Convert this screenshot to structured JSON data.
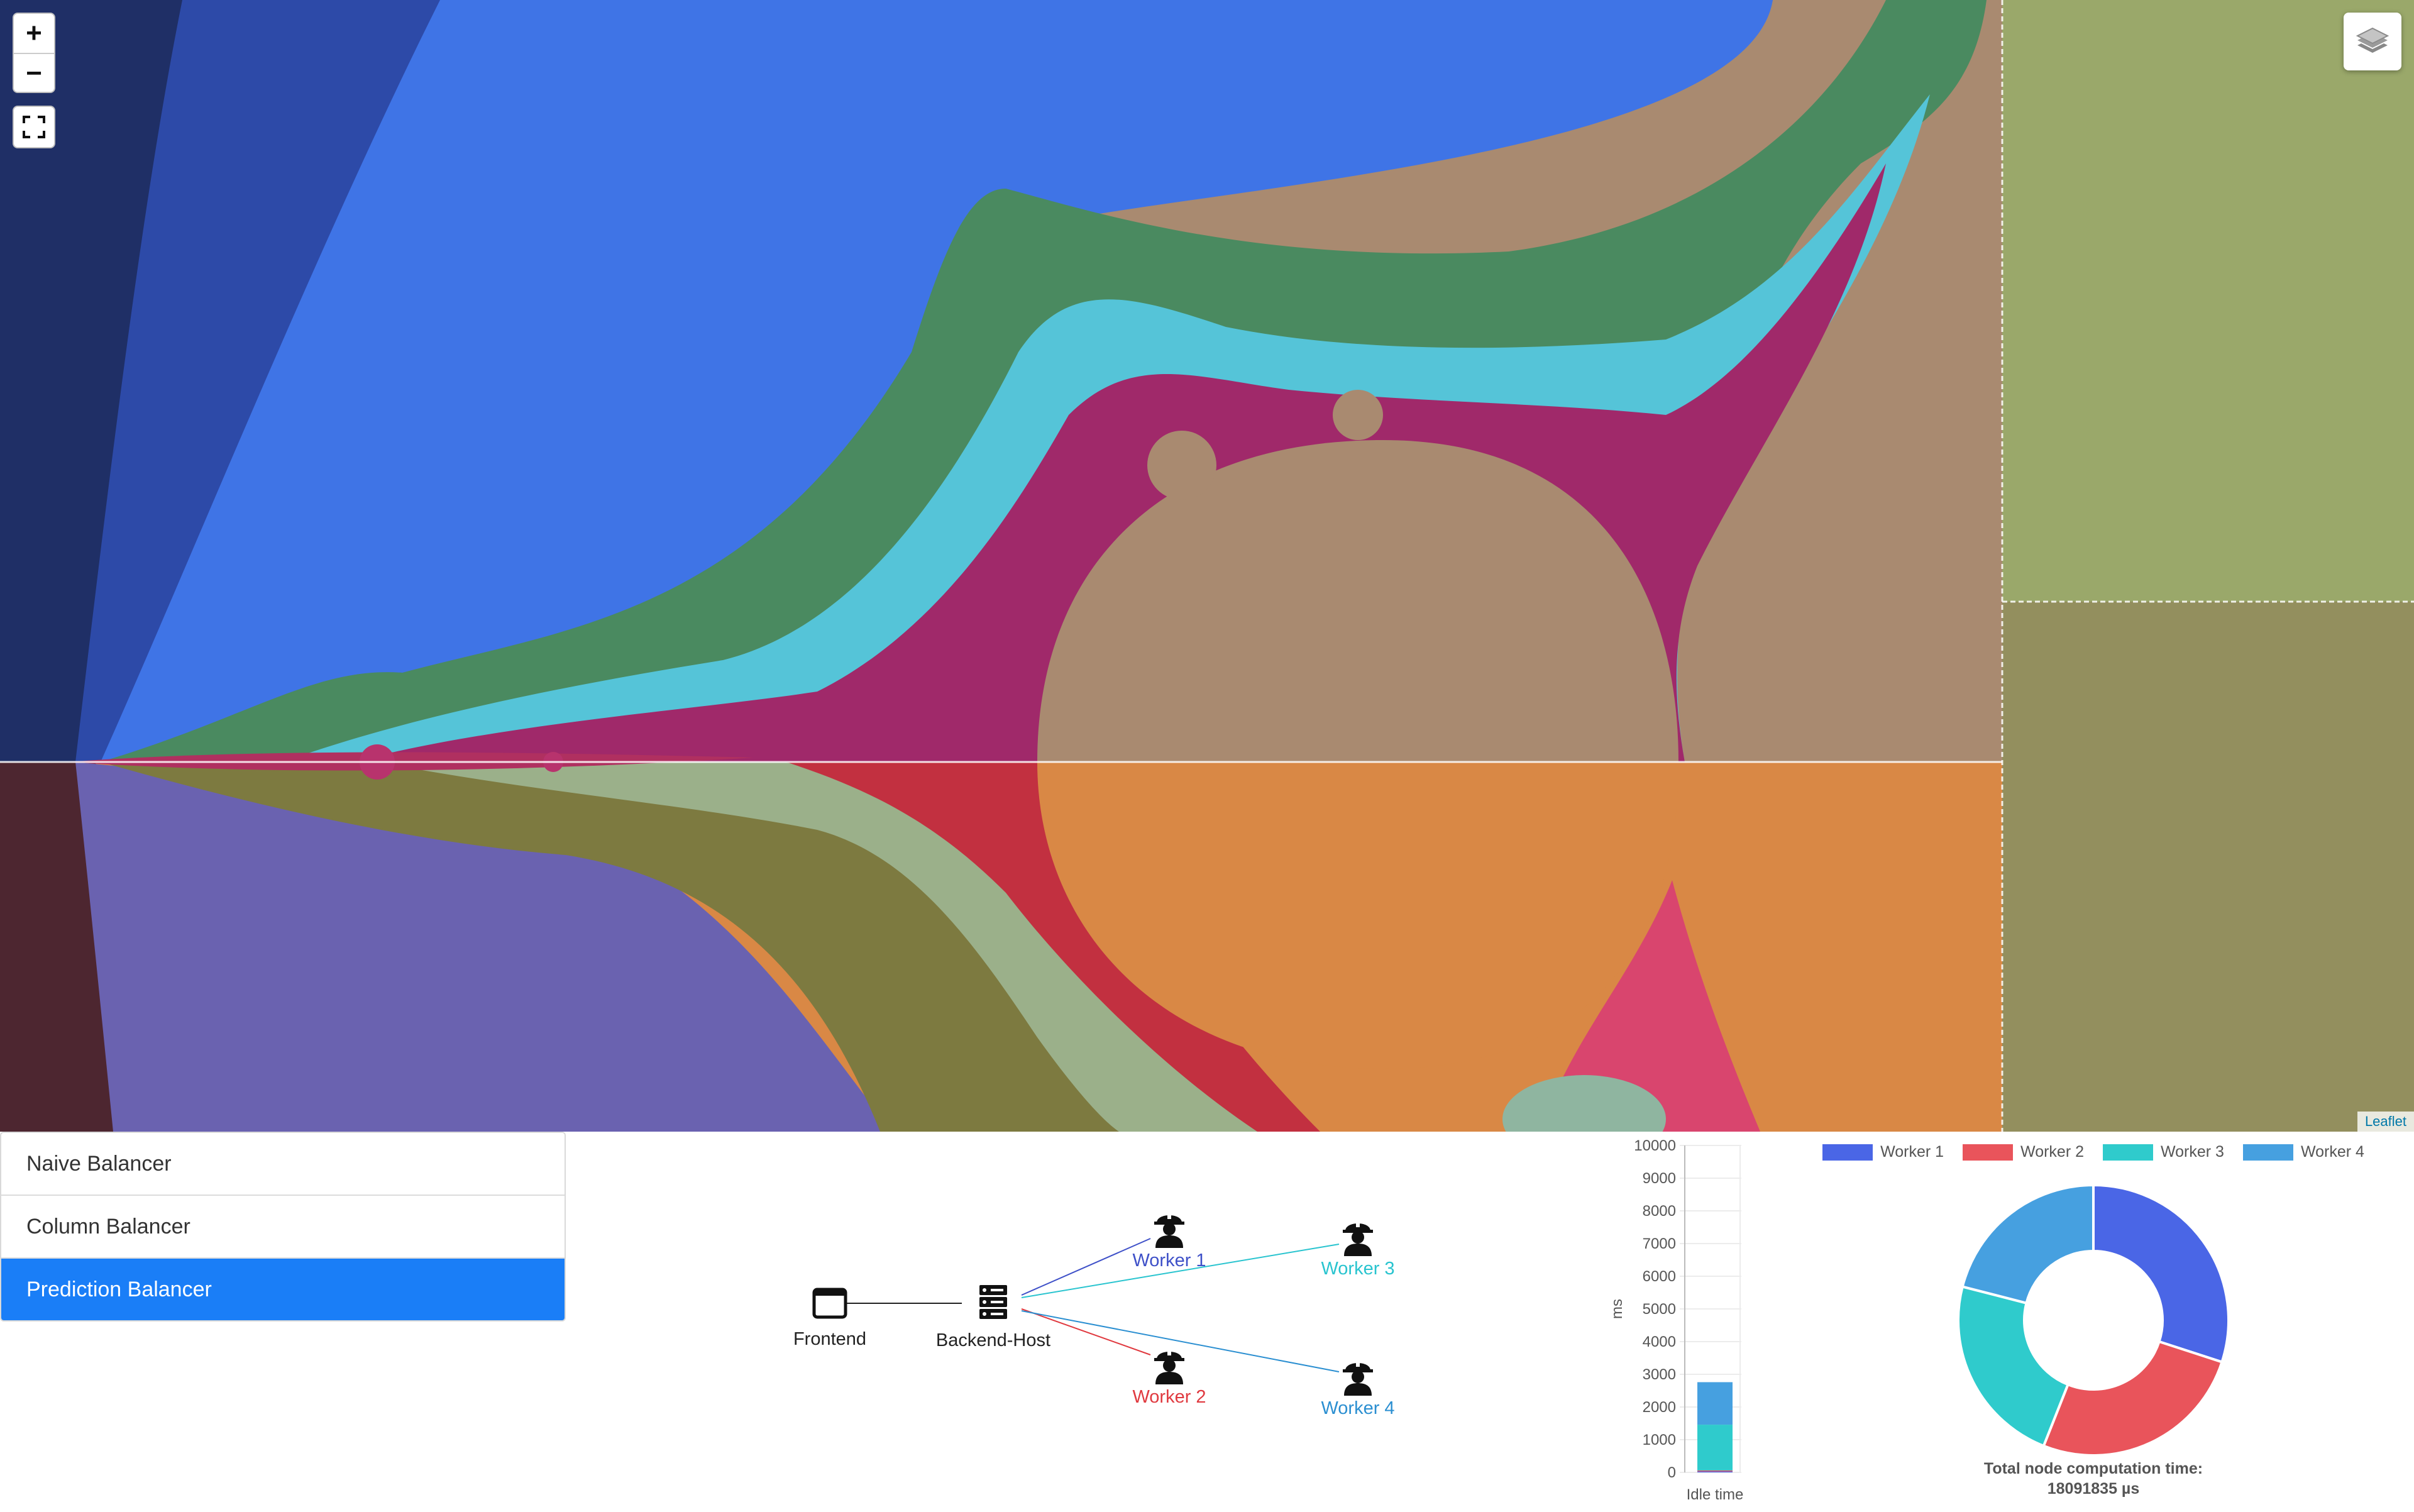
{
  "map": {
    "zoom_in_label": "+",
    "zoom_out_label": "−",
    "attribution": "Leaflet",
    "colors": {
      "deep_blue": "#1f2f66",
      "blue": "#3f74e6",
      "green": "#4a8a60",
      "cyan": "#55c4d8",
      "magenta": "#a0296a",
      "tan": "#a98a70",
      "orange": "#d98845",
      "maroon": "#4d2630",
      "purple": "#6a62b0",
      "olive": "#9aa86a",
      "olive_dark": "#938f5e"
    }
  },
  "balancers": {
    "items": [
      {
        "label": "Naive Balancer",
        "active": false
      },
      {
        "label": "Column Balancer",
        "active": false
      },
      {
        "label": "Prediction Balancer",
        "active": true
      }
    ]
  },
  "topology": {
    "frontend": "Frontend",
    "backend": "Backend-Host",
    "workers": [
      {
        "label": "Worker 1",
        "color": "#3e50c8"
      },
      {
        "label": "Worker 2",
        "color": "#e0393f"
      },
      {
        "label": "Worker 3",
        "color": "#29c4cf"
      },
      {
        "label": "Worker 4",
        "color": "#2b8fd1"
      }
    ]
  },
  "chart_data": [
    {
      "type": "bar",
      "categories": [
        "Idle time"
      ],
      "ylabel": "ms",
      "ylim": [
        0,
        10000
      ],
      "yticks": [
        0,
        1000,
        2000,
        3000,
        4000,
        5000,
        6000,
        7000,
        8000,
        9000,
        10000
      ],
      "stacked": true,
      "series": [
        {
          "name": "Worker 1",
          "values": [
            30
          ],
          "color": "#4a66e6"
        },
        {
          "name": "Worker 2",
          "values": [
            30
          ],
          "color": "#e9545b"
        },
        {
          "name": "Worker 3",
          "values": [
            1400
          ],
          "color": "#2fcbcc"
        },
        {
          "name": "Worker 4",
          "values": [
            1300
          ],
          "color": "#46a0e0"
        }
      ]
    },
    {
      "type": "pie",
      "donut": true,
      "labels": [
        "Worker 1",
        "Worker 2",
        "Worker 3",
        "Worker 4"
      ],
      "values": [
        30,
        26,
        23,
        21
      ],
      "colors": [
        "#4a66e6",
        "#e9545b",
        "#2fcbcc",
        "#46a0e0"
      ],
      "footer_line1": "Total node computation time:",
      "footer_line2": "18091835 µs"
    }
  ]
}
